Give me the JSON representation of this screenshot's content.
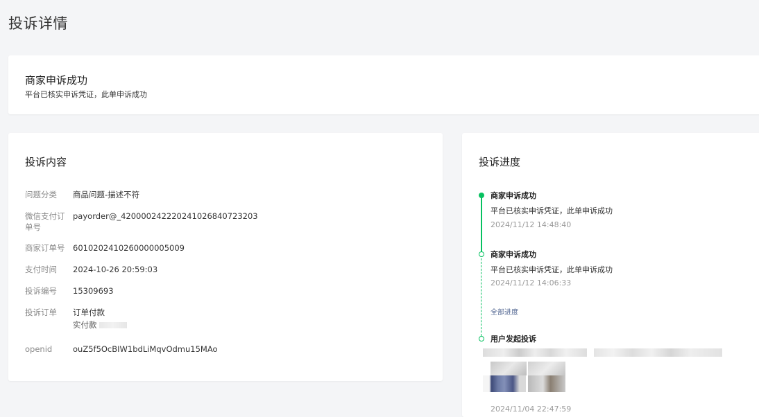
{
  "page": {
    "title": "投诉详情"
  },
  "status": {
    "title": "商家申诉成功",
    "desc": "平台已核实申诉凭证，此单申诉成功"
  },
  "content": {
    "title": "投诉内容",
    "rows": [
      {
        "label": "问题分类",
        "value": "商品问题-描述不符"
      },
      {
        "label": "微信支付订单号",
        "value": "payorder@_420000242220241026840723203"
      },
      {
        "label": "商家订单号",
        "value": "6010202410260000005009"
      },
      {
        "label": "支付时间",
        "value": "2024-10-26 20:59:03"
      },
      {
        "label": "投诉编号",
        "value": "15309693"
      },
      {
        "label": "投诉订单",
        "value": "订单付款",
        "sub": "实付款"
      },
      {
        "label": "openid",
        "value": "ouZ5f5OcBIW1bdLiMqvOdmu15MAo"
      }
    ]
  },
  "progress": {
    "title": "投诉进度",
    "items": [
      {
        "title": "商家申诉成功",
        "desc": "平台已核实申诉凭证，此单申诉成功",
        "time": "2024/11/12 14:48:40"
      },
      {
        "title": "商家申诉成功",
        "desc": "平台已核实申诉凭证，此单申诉成功",
        "time": "2024/11/12 14:06:33"
      },
      {
        "title": "用户发起投诉",
        "time": "2024/11/04 22:47:59"
      }
    ],
    "all_progress_link": "全部进度"
  },
  "colors": {
    "accent": "#07c160",
    "link": "#576b95",
    "background": "#f4f5f7"
  }
}
